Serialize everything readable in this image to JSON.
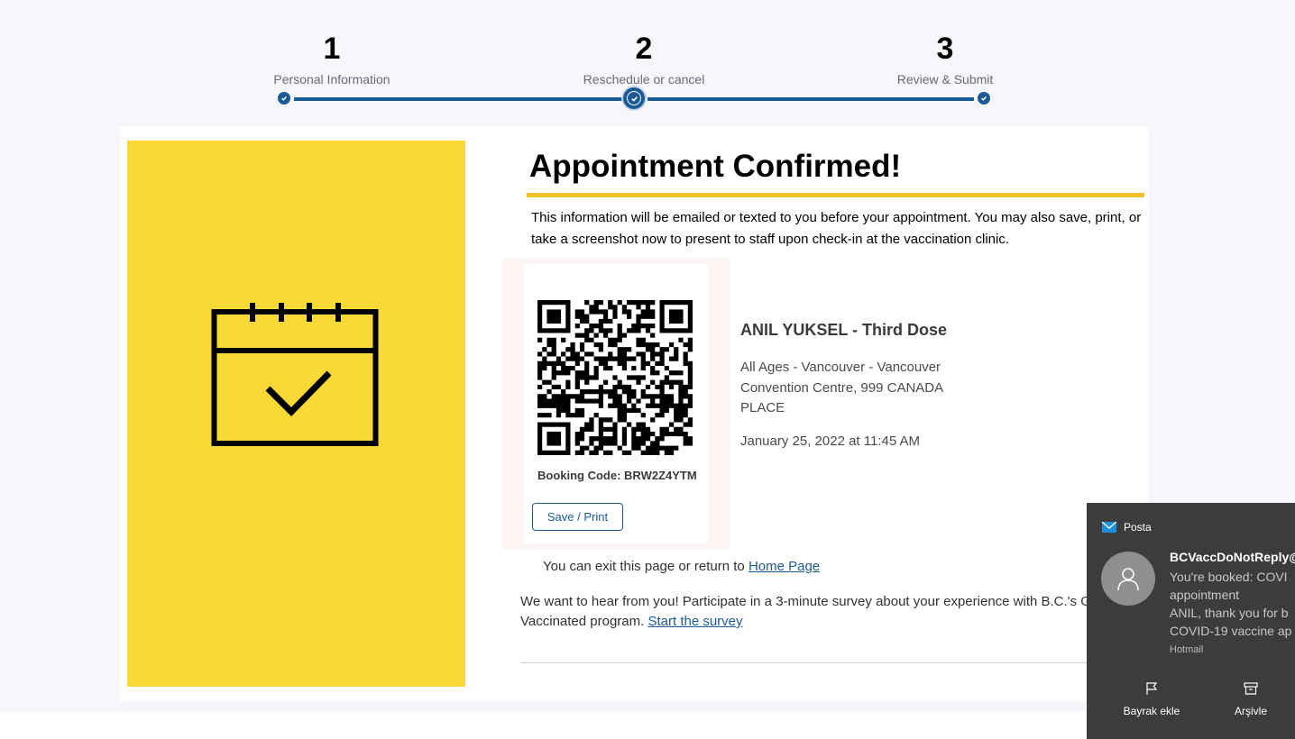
{
  "stepper": {
    "steps": [
      {
        "number": "1",
        "label": "Personal Information"
      },
      {
        "number": "2",
        "label": "Reschedule or cancel"
      },
      {
        "number": "3",
        "label": "Review & Submit"
      }
    ],
    "accent_color": "#1a5a96"
  },
  "confirmation": {
    "title": "Appointment Confirmed!",
    "intro": "This information will be emailed or texted to you before your appointment. You may also save, print, or take a screenshot now to present to staff upon check-in at the vaccination clinic.",
    "illustration_icon": "calendar-check-icon",
    "panel_color": "#f8d935",
    "title_rule_color": "#f2c12e"
  },
  "ticket": {
    "booking_code": "Booking Code: BRW2Z4YTM",
    "save_label": "Save / Print"
  },
  "appointment": {
    "name": "ANIL YUKSEL - Third Dose",
    "location": "All Ages - Vancouver - Vancouver Convention Centre, 999 CANADA PLACE",
    "datetime": "January 25, 2022 at 11:45 AM"
  },
  "footer": {
    "exit_text": "You can exit this page or return to ",
    "home_link": "Home Page",
    "survey_text": "We want to hear from you! Participate in a 3-minute survey about your experience with B.C.'s G",
    "survey_text_2": "Vaccinated program. ",
    "survey_link": "Start the survey"
  },
  "notification": {
    "app_name": "Posta",
    "sender": "BCVaccDoNotReply@",
    "subject": "You're booked: COVI",
    "subject_2": "appointment",
    "body": "ANIL, thank you for b",
    "body_2": "COVID-19 vaccine ap",
    "account": "Hotmail",
    "actions": [
      "Bayrak ekle",
      "Arşivle"
    ]
  }
}
